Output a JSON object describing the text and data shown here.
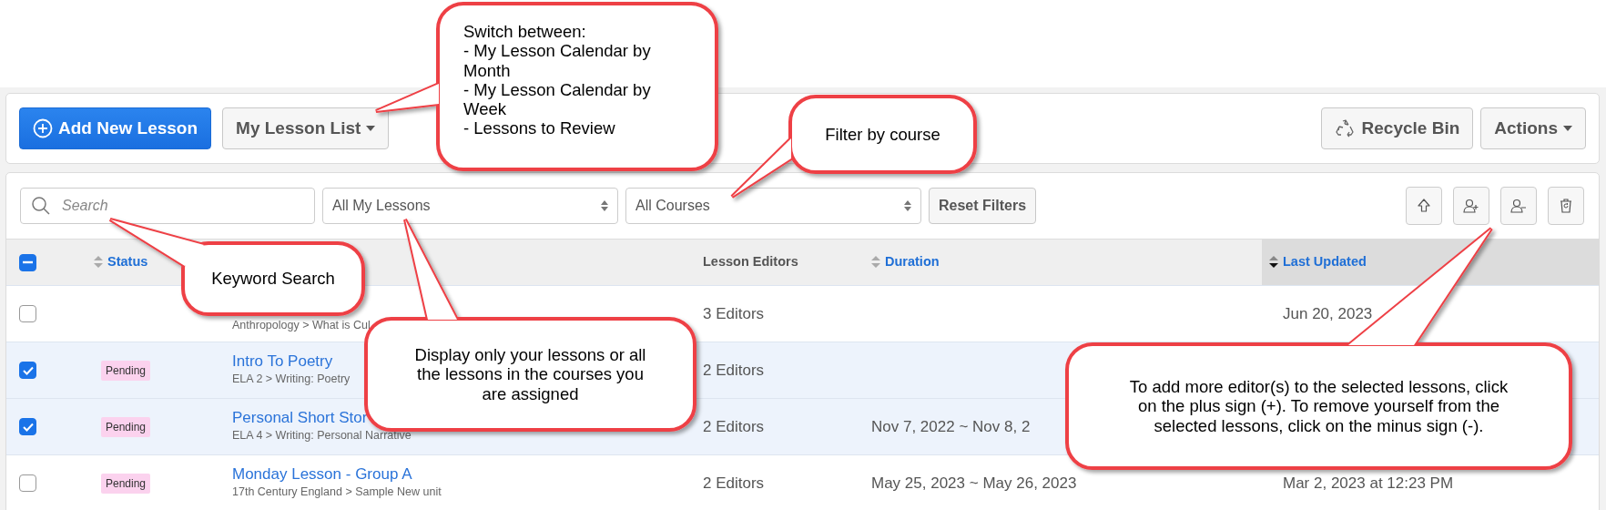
{
  "toolbar": {
    "add_button": "Add New Lesson",
    "view_menu": "My Lesson List",
    "recycle_button": "Recycle Bin",
    "actions_menu": "Actions"
  },
  "filters": {
    "search": {
      "placeholder": "Search"
    },
    "scope": "All My Lessons",
    "course": "All Courses",
    "reset_button": "Reset Filters"
  },
  "table": {
    "select_all": {
      "partial": true
    },
    "columns": [
      {
        "label": "Status",
        "sortable": true,
        "sorted": false
      },
      {
        "label": "Lesson Editors",
        "sortable": false,
        "sorted": false
      },
      {
        "label": "Duration",
        "sortable": true,
        "sorted": false
      },
      {
        "label": "Last Updated",
        "sortable": true,
        "sorted": true
      }
    ],
    "rows": [
      {
        "selected": false,
        "path": "Anthropology > What is Cul",
        "editors": "3 Editors",
        "last_updated": "Jun 20, 2023"
      },
      {
        "selected": true,
        "status": "Pending",
        "title": "Intro To Poetry",
        "path": "ELA 2 > Writing: Poetry",
        "editors": "2 Editors"
      },
      {
        "selected": true,
        "status": "Pending",
        "title": "Personal Short Stor",
        "path": "ELA 4 > Writing: Personal Narrative",
        "editors": "2 Editors",
        "duration": "Nov 7, 2022 ~ Nov 8, 2"
      },
      {
        "selected": false,
        "status": "Pending",
        "title": "Monday Lesson - Group A",
        "path": "17th Century England > Sample New unit",
        "editors": "2 Editors",
        "duration": "May 25, 2023 ~ May 26, 2023",
        "last_updated": "Mar 2, 2023 at 12:23 PM"
      }
    ]
  },
  "callouts": [
    {
      "lines": [
        "Switch between:",
        "- My Lesson Calendar by Month",
        "- My Lesson Calendar by Week",
        "- Lessons to Review"
      ]
    },
    {
      "lines": [
        "Filter by course"
      ]
    },
    {
      "lines": [
        "Keyword Search"
      ]
    },
    {
      "lines": [
        "Display only your lessons or all the lessons in the courses you are assigned"
      ]
    },
    {
      "lines": [
        "To add more editor(s) to the selected lessons, click on the plus sign (+). To remove yourself from the selected lessons, click on the minus sign (-)."
      ]
    }
  ]
}
